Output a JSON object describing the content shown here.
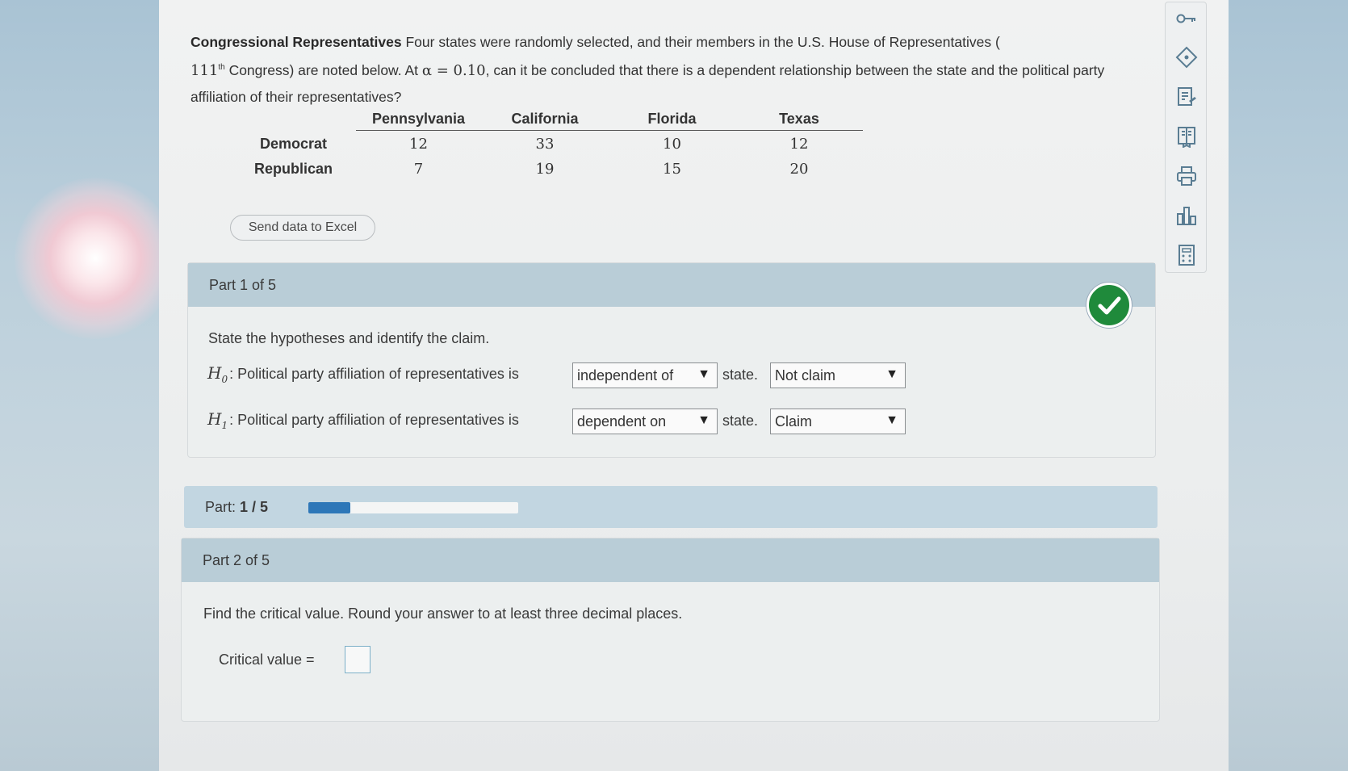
{
  "question": {
    "title": "Congressional Representatives",
    "text_part1": " Four states were randomly selected, and their members in the U.S. House of Representatives (",
    "congress_number": "111",
    "congress_suffix": "th",
    "text_part2": " Congress) are noted below. At ",
    "alpha_expr": "α = 0.10",
    "text_part3": ", can it be concluded that there is a dependent relationship between the state and the political party affiliation of their representatives?"
  },
  "table": {
    "columns": [
      "",
      "Pennsylvania",
      "California",
      "Florida",
      "Texas"
    ],
    "rows": [
      {
        "label": "Democrat",
        "values": [
          "12",
          "33",
          "10",
          "12"
        ]
      },
      {
        "label": "Republican",
        "values": [
          "7",
          "19",
          "15",
          "20"
        ]
      }
    ]
  },
  "excel_button": "Send data to Excel",
  "part1": {
    "header": "Part 1 of 5",
    "instruction": "State the hypotheses and identify the claim.",
    "h0": {
      "label": "H",
      "sub": "0",
      "text": ": Political party affiliation of representatives is",
      "relation": "independent of",
      "after": "state.",
      "claim": "Not claim"
    },
    "h1": {
      "label": "H",
      "sub": "1",
      "text": ": Political party affiliation of representatives is",
      "relation": "dependent on",
      "after": "state.",
      "claim": "Claim"
    },
    "status_icon": "checkmark-icon",
    "status_color": "#1f8a3b"
  },
  "progress": {
    "label": "Part: ",
    "value": "1 / 5",
    "fraction": 0.2,
    "color": "#2d77b8"
  },
  "part2": {
    "header": "Part 2 of 5",
    "instruction": "Find the critical value. Round your answer to at least three decimal places.",
    "answer_label": "Critical value =",
    "answer_value": ""
  },
  "toolbar_icons": [
    "key-icon",
    "tag-icon",
    "notes-icon",
    "book-icon",
    "print-icon",
    "chart-icon",
    "calculator-icon"
  ]
}
